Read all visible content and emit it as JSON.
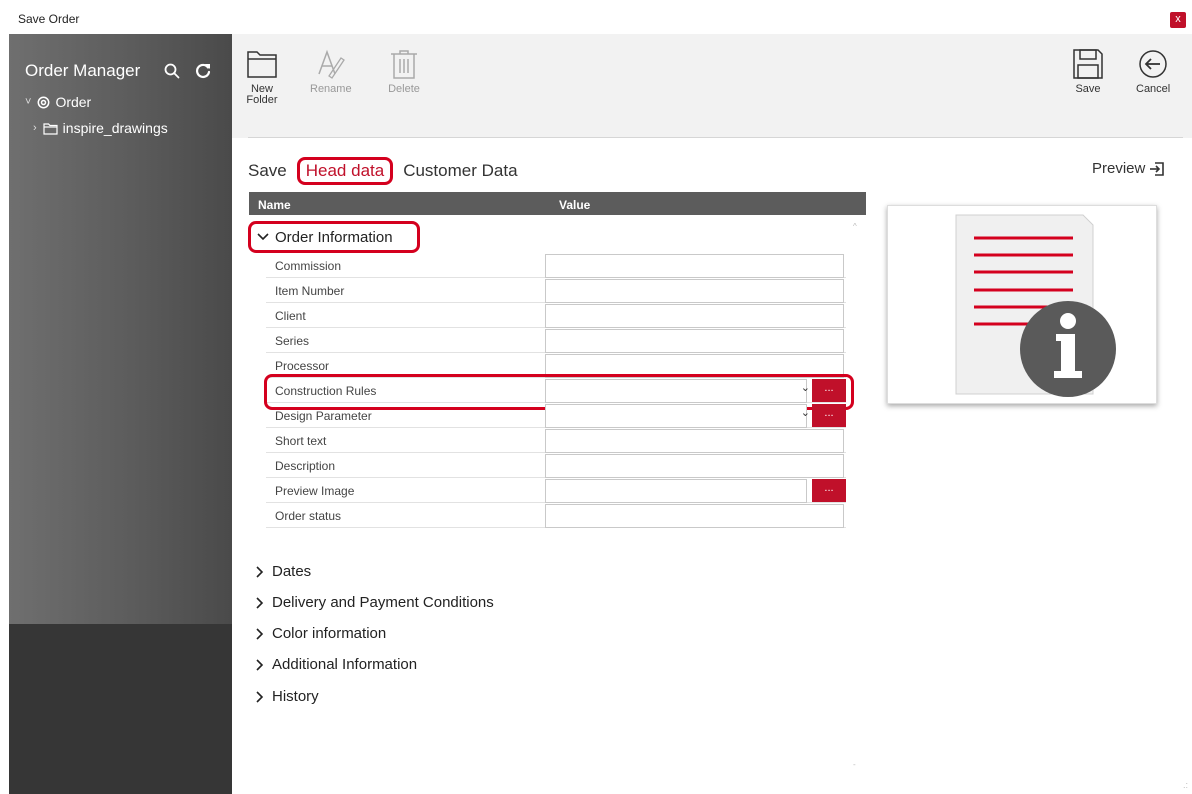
{
  "window": {
    "title": "Save Order",
    "close_label": "x"
  },
  "sidebar": {
    "title": "Order Manager",
    "tree": [
      {
        "label": "Order",
        "chevron": "˅"
      },
      {
        "label": "inspire_drawings",
        "chevron": "›"
      }
    ]
  },
  "toolbar": {
    "new_folder": "New\nFolder",
    "rename": "Rename",
    "delete": "Delete",
    "save": "Save",
    "cancel": "Cancel"
  },
  "tabs": {
    "save": "Save",
    "head_data": "Head data",
    "customer_data": "Customer Data",
    "active": "Head data"
  },
  "preview_link": "Preview",
  "grid": {
    "col_name": "Name",
    "col_value": "Value",
    "open_group": "Order Information",
    "rows": [
      {
        "name": "Commission",
        "value": ""
      },
      {
        "name": "Item Number",
        "value": ""
      },
      {
        "name": "Client",
        "value": ""
      },
      {
        "name": "Series",
        "value": ""
      },
      {
        "name": "Processor",
        "value": ""
      },
      {
        "name": "Construction Rules",
        "value": "",
        "button": "..."
      },
      {
        "name": "Design Parameter",
        "value": "",
        "button": "..."
      },
      {
        "name": "Short text",
        "value": ""
      },
      {
        "name": "Description",
        "value": ""
      },
      {
        "name": "Preview Image",
        "value": "",
        "button": "..."
      },
      {
        "name": "Order status",
        "value": ""
      }
    ],
    "collapsed_groups": [
      "Dates",
      "Delivery and Payment Conditions",
      "Color information",
      "Additional Information",
      "History"
    ]
  },
  "colors": {
    "accent": "#c0102a",
    "sidebar": "#5c5c5c",
    "grid_header": "#5c5c5c"
  }
}
